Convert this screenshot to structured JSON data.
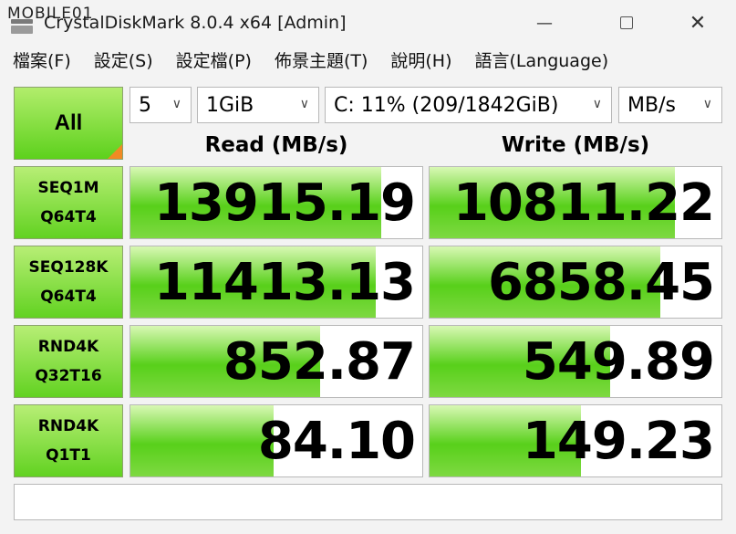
{
  "watermark": "MOBILE01",
  "window": {
    "title": "CrystalDiskMark 8.0.4 x64 [Admin]",
    "minimize": "—",
    "close": "✕"
  },
  "menu": [
    "檔案(F)",
    "設定(S)",
    "設定檔(P)",
    "佈景主題(T)",
    "說明(H)",
    "語言(Language)"
  ],
  "controls": {
    "all_label": "All",
    "count": "5",
    "size": "1GiB",
    "drive": "C: 11% (209/1842GiB)",
    "unit": "MB/s"
  },
  "headers": {
    "read": "Read (MB/s)",
    "write": "Write (MB/s)"
  },
  "tests": [
    {
      "line1": "SEQ1M",
      "line2": "Q64T4",
      "read": "13915.19",
      "write": "10811.22",
      "read_fill": 0.86,
      "write_fill": 0.84
    },
    {
      "line1": "SEQ128K",
      "line2": "Q64T4",
      "read": "11413.13",
      "write": "6858.45",
      "read_fill": 0.84,
      "write_fill": 0.79
    },
    {
      "line1": "RND4K",
      "line2": "Q32T16",
      "read": "852.87",
      "write": "549.89",
      "read_fill": 0.65,
      "write_fill": 0.62
    },
    {
      "line1": "RND4K",
      "line2": "Q1T1",
      "read": "84.10",
      "write": "149.23",
      "read_fill": 0.49,
      "write_fill": 0.52
    }
  ],
  "status_text": ""
}
